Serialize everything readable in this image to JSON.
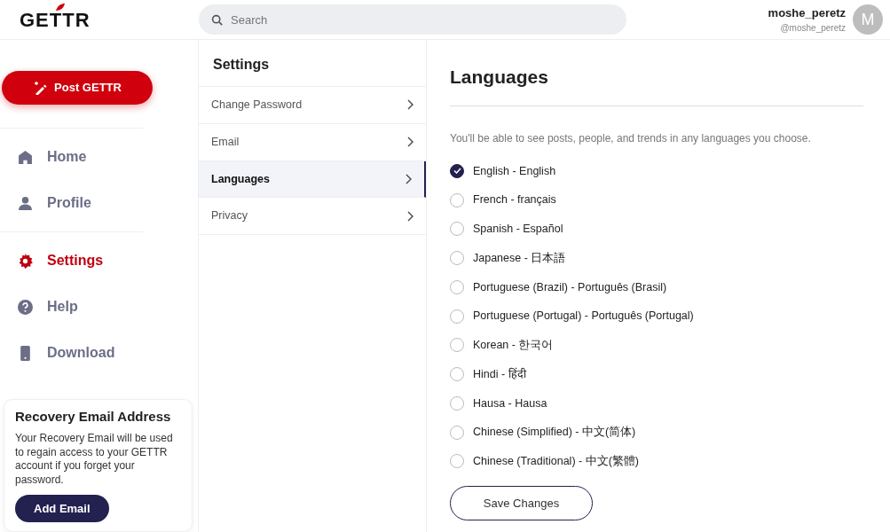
{
  "header": {
    "logo": "GETTR",
    "search": {
      "placeholder": "Search"
    },
    "user": {
      "name": "moshe_peretz",
      "handle": "@moshe_peretz",
      "avatar_letter": "M"
    }
  },
  "sidebar": {
    "post_button": "Post GETTR",
    "nav_groups": [
      [
        {
          "label": "Home",
          "kind": "home",
          "selected": false
        },
        {
          "label": "Profile",
          "kind": "person",
          "selected": false
        }
      ],
      [
        {
          "label": "Settings",
          "kind": "gear",
          "selected": true
        },
        {
          "label": "Help",
          "kind": "help",
          "selected": false
        },
        {
          "label": "Download",
          "kind": "phone",
          "selected": false
        }
      ]
    ],
    "recovery_card": {
      "title": "Recovery Email Address",
      "text": "Your Recovery Email will be used to regain access to your GETTR account if you forget your password.",
      "button": "Add Email"
    }
  },
  "settings_menu": {
    "title": "Settings",
    "items": [
      {
        "label": "Change Password",
        "selected": false
      },
      {
        "label": "Email",
        "selected": false
      },
      {
        "label": "Languages",
        "selected": true
      },
      {
        "label": "Privacy",
        "selected": false
      }
    ]
  },
  "languages": {
    "title": "Languages",
    "description": "You'll be able to see posts, people, and trends in any languages you choose.",
    "options": [
      {
        "label": "English - English",
        "checked": true
      },
      {
        "label": "French - français",
        "checked": false
      },
      {
        "label": "Spanish - Español",
        "checked": false
      },
      {
        "label": "Japanese - 日本語",
        "checked": false
      },
      {
        "label": "Portuguese (Brazil) - Português (Brasil)",
        "checked": false
      },
      {
        "label": "Portuguese (Portugal) - Português (Portugal)",
        "checked": false
      },
      {
        "label": "Korean - 한국어",
        "checked": false
      },
      {
        "label": "Hindi - हिंदी",
        "checked": false
      },
      {
        "label": "Hausa - Hausa",
        "checked": false
      },
      {
        "label": "Chinese (Simplified) - 中文(简体)",
        "checked": false
      },
      {
        "label": "Chinese (Traditional) - 中文(繁體)",
        "checked": false
      }
    ],
    "save_button": "Save Changes"
  }
}
